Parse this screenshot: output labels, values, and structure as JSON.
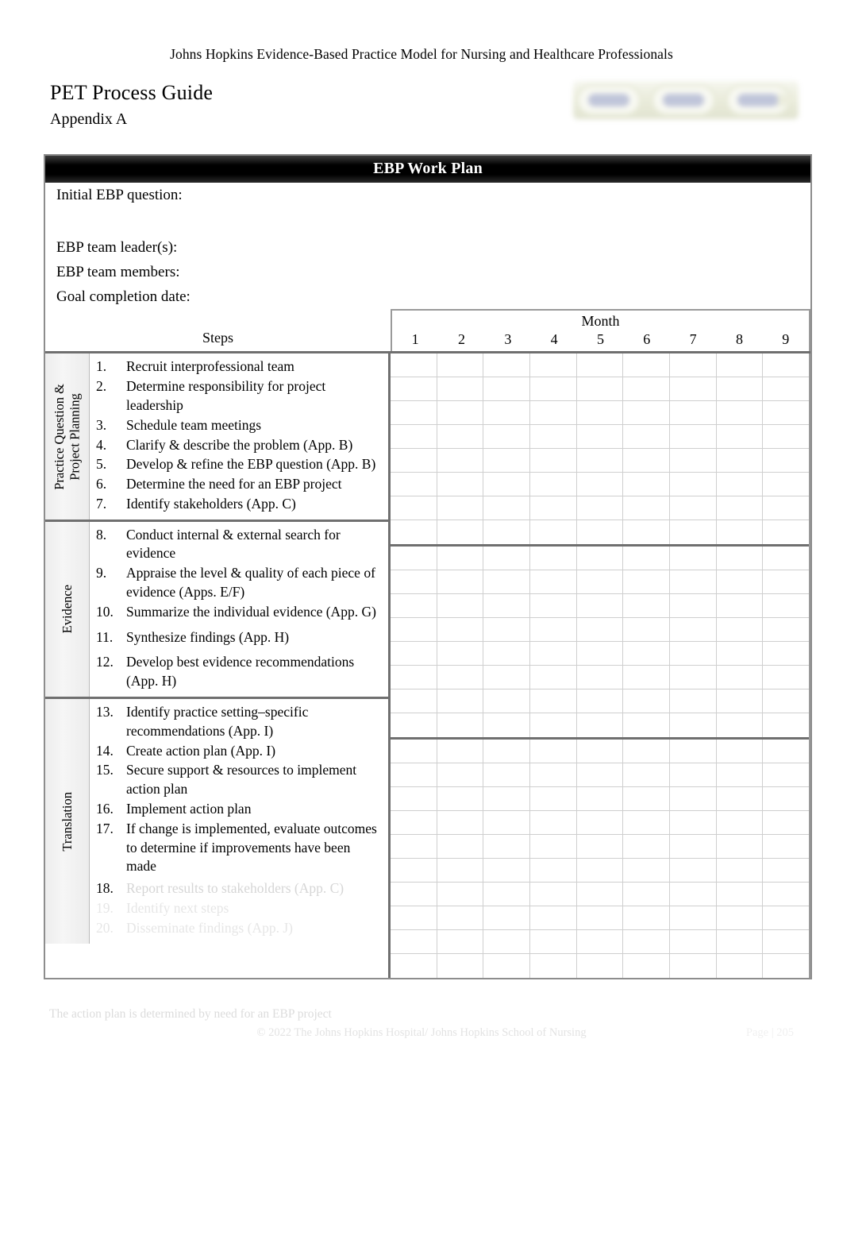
{
  "header": {
    "model_line": "Johns Hopkins Evidence-Based Practice Model for Nursing and Healthcare Professionals",
    "doc_title": "PET Process Guide",
    "appendix": "Appendix A",
    "logo": {
      "name": "pet-model-logo",
      "segments": [
        "Practice Question",
        "Evidence",
        "Translation"
      ]
    }
  },
  "work_plan": {
    "title": "EBP Work Plan",
    "fields": [
      {
        "label": "Initial EBP question:",
        "value": ""
      },
      {
        "label": "EBP team leader(s):",
        "value": ""
      },
      {
        "label": "EBP team members:",
        "value": ""
      },
      {
        "label": "Goal completion date:",
        "value": ""
      }
    ],
    "steps_header": "Steps",
    "month_header": "Month",
    "months": [
      "1",
      "2",
      "3",
      "4",
      "5",
      "6",
      "7",
      "8",
      "9"
    ],
    "phases": [
      {
        "label": "Practice Question &\nProject Planning",
        "label_plain": "Practice Question & Project Planning",
        "steps": [
          {
            "num": "1.",
            "text": "Recruit interprofessional team"
          },
          {
            "num": "2.",
            "text": "Determine responsibility for project leadership"
          },
          {
            "num": "3.",
            "text": "Schedule team meetings"
          },
          {
            "num": "4.",
            "text": "Clarify & describe the problem (App. B)"
          },
          {
            "num": "5.",
            "text": "Develop & refine the EBP question (App. B)"
          },
          {
            "num": "6.",
            "text": "Determine the need for an EBP project"
          },
          {
            "num": "7.",
            "text": "Identify stakeholders (App. C)"
          }
        ],
        "grid_rows": 8
      },
      {
        "label": "Evidence",
        "label_plain": "Evidence",
        "steps": [
          {
            "num": "8.",
            "text": "Conduct internal & external search for evidence"
          },
          {
            "num": "9.",
            "text": "Appraise the level & quality of each piece of evidence (Apps. E/F)"
          },
          {
            "num": "10.",
            "text": "Summarize the individual evidence (App. G)"
          },
          {
            "num": "11.",
            "text": "Synthesize findings (App. H)"
          },
          {
            "num": "12.",
            "text": "Develop best evidence recommendations (App. H)"
          }
        ],
        "grid_rows": 8
      },
      {
        "label": "Translation",
        "label_plain": "Translation",
        "steps": [
          {
            "num": "13.",
            "text": "Identify practice setting–specific recommendations (App. I)"
          },
          {
            "num": "14.",
            "text": "Create action plan (App. I)"
          },
          {
            "num": "15.",
            "text": "Secure support & resources to implement action plan"
          },
          {
            "num": "16.",
            "text": "Implement action plan"
          },
          {
            "num": "17.",
            "text": "If change is implemented, evaluate outcomes to determine if improvements have been made"
          },
          {
            "num": "18.",
            "text": "Report results to stakeholders (App. C)"
          },
          {
            "num": "19.",
            "text": "Identify next steps"
          },
          {
            "num": "20.",
            "text": "Disseminate findings (App. J)"
          }
        ],
        "grid_rows": 10
      }
    ]
  },
  "footer": {
    "note": "The action plan is determined by need for an EBP project",
    "copyright": "© 2022 The Johns Hopkins Hospital/ Johns Hopkins School of Nursing",
    "page": "Page | 205"
  },
  "colors": {
    "title_bar": "#000000",
    "title_text": "#ffffff",
    "frame_border": "#8d8d8d",
    "section_divider": "#6f6f6f",
    "grid_line": "#cfcfcf",
    "phase_label_bg": "#efefef",
    "logo_pill": "#b6bcd4"
  }
}
